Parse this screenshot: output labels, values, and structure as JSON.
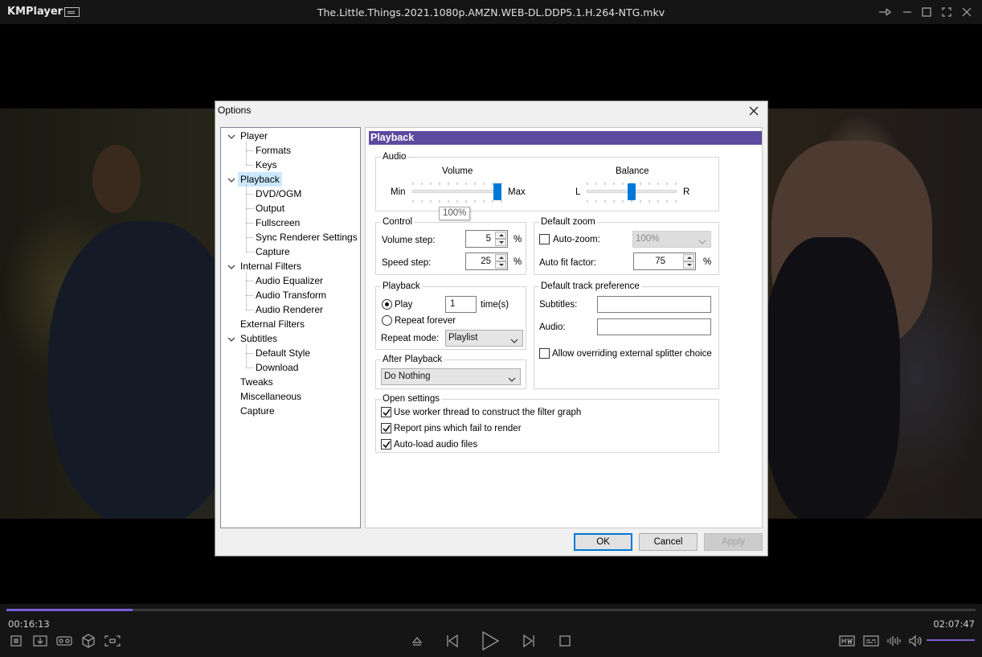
{
  "app": {
    "name": "KMPlayer",
    "file_title": "The.Little.Things.2021.1080p.AMZN.WEB-DL.DDP5.1.H.264-NTG.mkv"
  },
  "player": {
    "time_elapsed": "00:16:13",
    "time_total": "02:07:47",
    "progress_fraction": 0.13,
    "accent_color": "#7b5cd6"
  },
  "dialog": {
    "title": "Options",
    "tree": [
      {
        "label": "Player",
        "level": 0,
        "expanded": true
      },
      {
        "label": "Formats",
        "level": 1
      },
      {
        "label": "Keys",
        "level": 1
      },
      {
        "label": "Playback",
        "level": 0,
        "expanded": true,
        "selected": true
      },
      {
        "label": "DVD/OGM",
        "level": 1
      },
      {
        "label": "Output",
        "level": 1
      },
      {
        "label": "Fullscreen",
        "level": 1
      },
      {
        "label": "Sync Renderer Settings",
        "level": 1
      },
      {
        "label": "Capture",
        "level": 1
      },
      {
        "label": "Internal Filters",
        "level": 0,
        "expanded": true
      },
      {
        "label": "Audio Equalizer",
        "level": 1
      },
      {
        "label": "Audio Transform",
        "level": 1
      },
      {
        "label": "Audio Renderer",
        "level": 1
      },
      {
        "label": "External Filters",
        "level": 0
      },
      {
        "label": "Subtitles",
        "level": 0,
        "expanded": true
      },
      {
        "label": "Default Style",
        "level": 1
      },
      {
        "label": "Download",
        "level": 1
      },
      {
        "label": "Tweaks",
        "level": 0
      },
      {
        "label": "Miscellaneous",
        "level": 0
      },
      {
        "label": "Capture",
        "level": 0
      }
    ],
    "panel": {
      "header": "Playback",
      "audio": {
        "group_label": "Audio",
        "volume_label": "Volume",
        "volume_min": "Min",
        "volume_max": "Max",
        "volume_fraction": 0.96,
        "volume_tooltip": "100%",
        "balance_label": "Balance",
        "balance_left": "L",
        "balance_right": "R",
        "balance_fraction": 0.5
      },
      "control": {
        "group_label": "Control",
        "volume_step_label": "Volume step:",
        "volume_step_value": "5",
        "volume_step_unit": "%",
        "speed_step_label": "Speed step:",
        "speed_step_value": "25",
        "speed_step_unit": "%"
      },
      "default_zoom": {
        "group_label": "Default zoom",
        "auto_zoom_label": "Auto-zoom:",
        "auto_zoom_checked": false,
        "auto_zoom_value": "100%",
        "auto_fit_label": "Auto fit factor:",
        "auto_fit_value": "75",
        "auto_fit_unit": "%"
      },
      "playback": {
        "group_label": "Playback",
        "play_label": "Play",
        "play_times_value": "1",
        "times_unit": "time(s)",
        "repeat_forever_label": "Repeat forever",
        "repeat_mode_label": "Repeat mode:",
        "repeat_mode_value": "Playlist"
      },
      "track_pref": {
        "group_label": "Default track preference",
        "subtitles_label": "Subtitles:",
        "subtitles_value": "",
        "audio_label": "Audio:",
        "audio_value": "",
        "allow_override_label": "Allow overriding external splitter choice",
        "allow_override_checked": false
      },
      "after_playback": {
        "group_label": "After Playback",
        "value": "Do Nothing"
      },
      "open_settings": {
        "group_label": "Open settings",
        "options": [
          {
            "label": "Use worker thread to construct the filter graph",
            "checked": true
          },
          {
            "label": "Report pins which fail to render",
            "checked": true
          },
          {
            "label": "Auto-load audio files",
            "checked": true
          }
        ]
      }
    },
    "buttons": {
      "ok": "OK",
      "cancel": "Cancel",
      "apply": "Apply"
    },
    "header_color": "#5b4a9e",
    "selection_color": "#cce8ff"
  }
}
